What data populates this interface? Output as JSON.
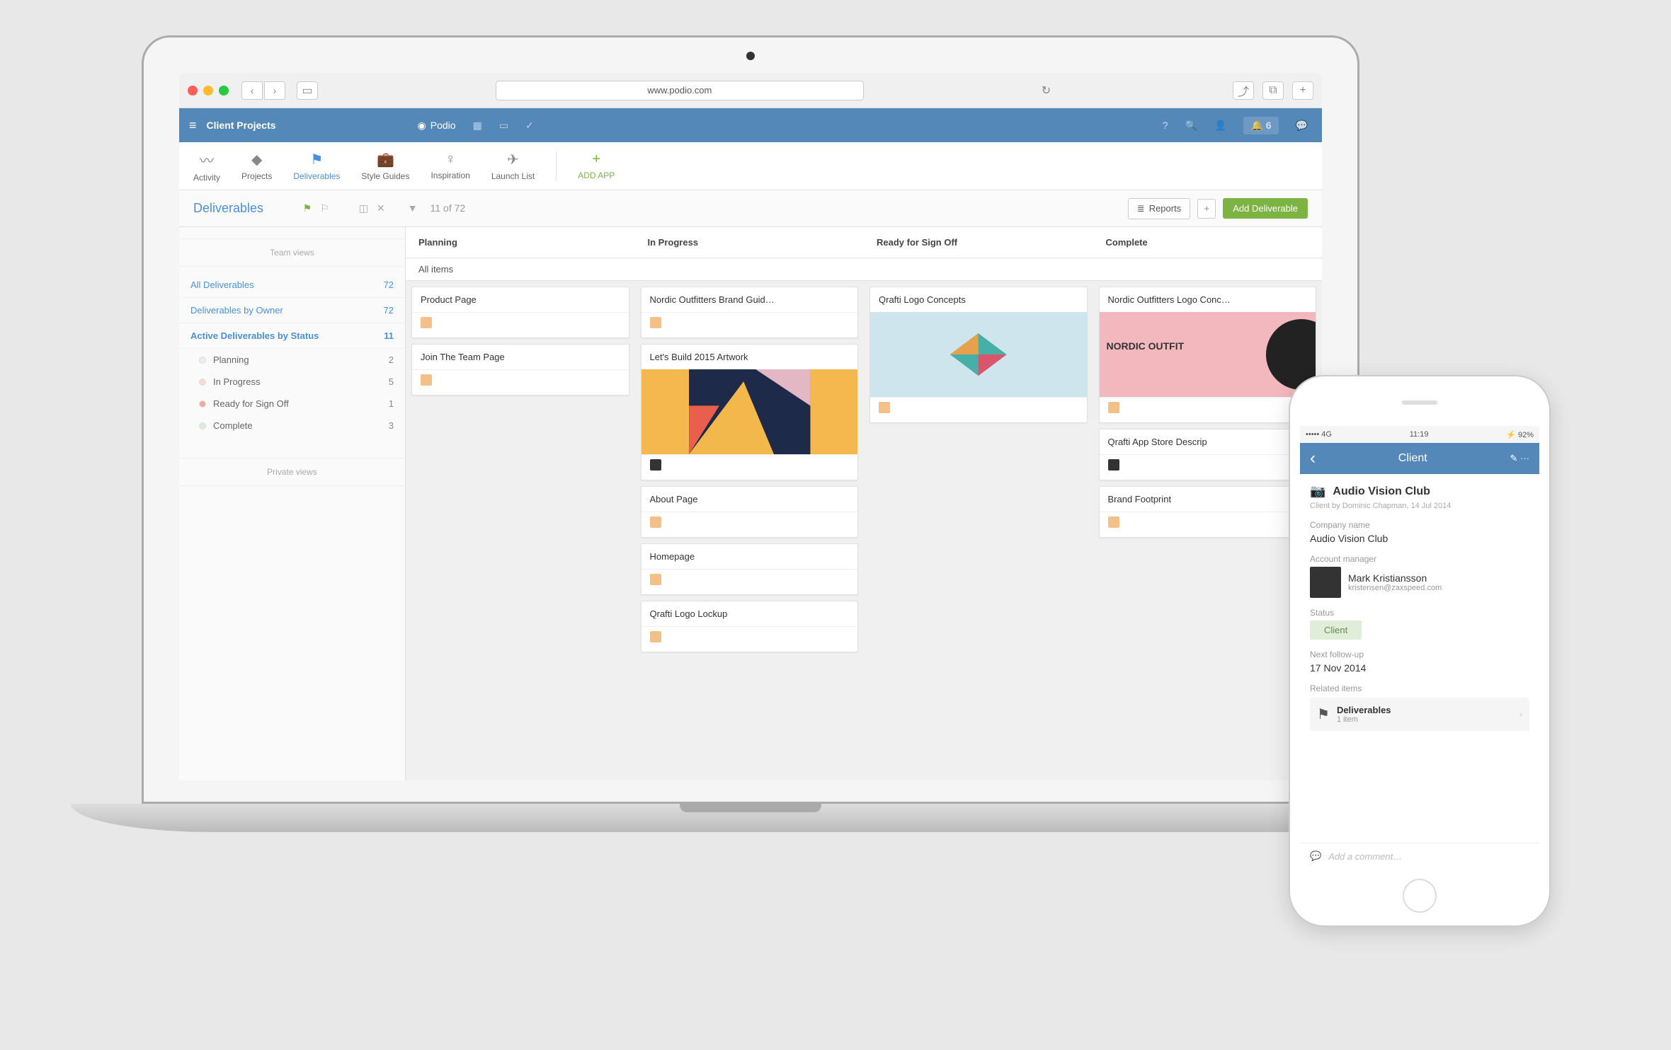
{
  "browser": {
    "url": "www.podio.com"
  },
  "topbar": {
    "workspace": "Client Projects",
    "brand": "Podio",
    "notif_count": "6"
  },
  "tabs": {
    "activity": "Activity",
    "projects": "Projects",
    "deliverables": "Deliverables",
    "style_guides": "Style Guides",
    "inspiration": "Inspiration",
    "launch_list": "Launch List",
    "add_app": "ADD APP"
  },
  "toolbar": {
    "title": "Deliverables",
    "count": "11 of 72",
    "reports": "Reports",
    "add": "Add Deliverable"
  },
  "sidebar": {
    "team_header": "Team views",
    "private_header": "Private views",
    "views": [
      {
        "label": "All Deliverables",
        "count": "72"
      },
      {
        "label": "Deliverables by Owner",
        "count": "72"
      },
      {
        "label": "Active Deliverables by Status",
        "count": "11"
      }
    ],
    "statuses": [
      {
        "label": "Planning",
        "count": "2",
        "color": "#eeeeee"
      },
      {
        "label": "In Progress",
        "count": "5",
        "color": "#f7dada"
      },
      {
        "label": "Ready for Sign Off",
        "count": "1",
        "color": "#f5a89c"
      },
      {
        "label": "Complete",
        "count": "3",
        "color": "#d5f0d8"
      }
    ]
  },
  "board": {
    "all_items": "All items",
    "columns": [
      {
        "name": "Planning",
        "cards": [
          {
            "title": "Product Page"
          },
          {
            "title": "Join The Team Page"
          }
        ]
      },
      {
        "name": "In Progress",
        "cards": [
          {
            "title": "Nordic Outfitters Brand Guid…"
          },
          {
            "title": "Let's Build 2015 Artwork",
            "image": true,
            "dark": true
          },
          {
            "title": "About Page"
          },
          {
            "title": "Homepage"
          },
          {
            "title": "Qrafti Logo Lockup"
          }
        ]
      },
      {
        "name": "Ready for Sign Off",
        "cards": [
          {
            "title": "Qrafti Logo Concepts",
            "image": "qrafti"
          }
        ]
      },
      {
        "name": "Complete",
        "cards": [
          {
            "title": "Nordic Outfitters Logo Conc…",
            "image": "nordic"
          },
          {
            "title": "Qrafti App Store Descrip",
            "dark": true
          },
          {
            "title": "Brand Footprint"
          }
        ]
      }
    ]
  },
  "phone": {
    "status": {
      "carrier": "••••• 4G",
      "time": "11:19",
      "battery": "92%"
    },
    "header": {
      "back": "‹",
      "title": "Client"
    },
    "record": {
      "title": "Audio Vision Club",
      "subtitle": "Client by Dominic Chapman, 14 Jul 2014",
      "company_label": "Company name",
      "company": "Audio Vision Club",
      "mgr_label": "Account manager",
      "mgr_name": "Mark Kristiansson",
      "mgr_email": "kristensen@zaxspeed.com",
      "status_label": "Status",
      "status": "Client",
      "followup_label": "Next follow-up",
      "followup": "17 Nov 2014",
      "related_label": "Related items",
      "related_title": "Deliverables",
      "related_count": "1 item",
      "comment_placeholder": "Add a comment…"
    }
  }
}
